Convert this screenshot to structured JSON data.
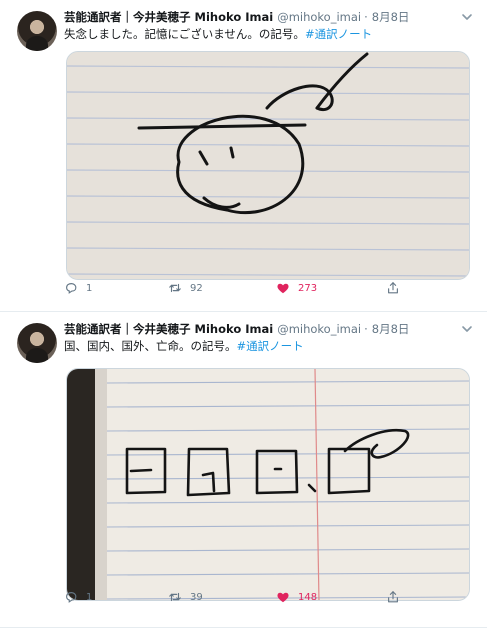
{
  "tweets": [
    {
      "author_name": "芸能通訳者｜今井美穂子 Mihoko Imai",
      "handle": "@mihoko_imai",
      "separator": "·",
      "date": "8月8日",
      "text": "失念しました。記憶にございません。の記号。",
      "hashtag": "#通訳ノート",
      "replies": "1",
      "retweets": "92",
      "likes": "273",
      "liked": true
    },
    {
      "author_name": "芸能通訳者｜今井美穂子 Mihoko Imai",
      "handle": "@mihoko_imai",
      "separator": "·",
      "date": "8月8日",
      "text": "国、国内、国外、亡命。の記号。",
      "hashtag": "#通訳ノート",
      "replies": "1",
      "retweets": "39",
      "likes": "148",
      "liked": true
    }
  ],
  "icons": {
    "reply": "reply-icon",
    "retweet": "retweet-icon",
    "like": "heart-icon",
    "share": "share-icon",
    "caret": "chevron-down-icon"
  },
  "colors": {
    "link": "#1b95e0",
    "like_active": "#e0245e",
    "muted": "#657786"
  }
}
